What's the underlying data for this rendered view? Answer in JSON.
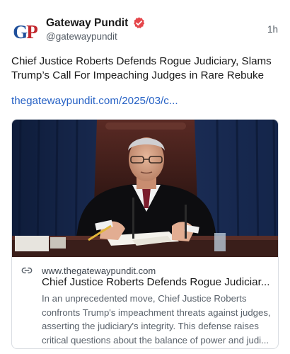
{
  "post": {
    "author_name": "Gateway Pundit",
    "author_handle": "@gatewaypundit",
    "avatar_initials": {
      "first": "G",
      "second": "P"
    },
    "timestamp": "1h",
    "text": "Chief Justice Roberts Defends Rogue Judiciary, Slams Trump’s Call For Impeaching Judges in Rare Rebuke",
    "link_text": "thegatewaypundit.com/2025/03/c..."
  },
  "card": {
    "domain": "www.thegatewaypundit.com",
    "title": "Chief Justice Roberts Defends Rogue Judiciar...",
    "description": "In an unprecedented move, Chief Justice Roberts confronts Trump's impeachment threats against judges, asserting the judiciary's integrity. This defense raises critical questions about the balance of power and judi...",
    "image_icon": "photo-of-chief-justice-at-podium"
  },
  "colors": {
    "link": "#2762c5",
    "verified_badge": "#e5464b",
    "avatar_g": "#1f4f9a",
    "avatar_p": "#c2272d",
    "card_border": "#d9dde2"
  }
}
